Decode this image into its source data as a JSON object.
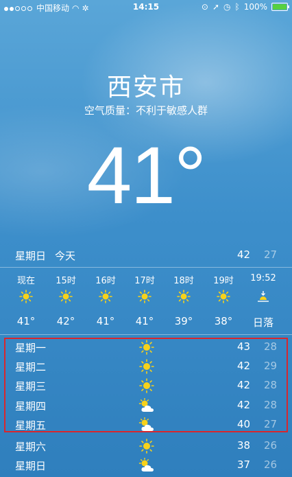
{
  "status_bar": {
    "carrier": "中国移动",
    "time": "14:15",
    "battery": "100%"
  },
  "location": {
    "city": "西安市",
    "air_quality": "空气质量：不利于敏感人群",
    "current_temp": "41°"
  },
  "today": {
    "day": "星期日",
    "label": "今天",
    "high": "42",
    "low": "27"
  },
  "hourly": [
    {
      "time": "现在",
      "icon": "sun-icon",
      "temp": "41°"
    },
    {
      "time": "15时",
      "icon": "sun-icon",
      "temp": "42°"
    },
    {
      "time": "16时",
      "icon": "sun-icon",
      "temp": "41°"
    },
    {
      "time": "17时",
      "icon": "sun-icon",
      "temp": "41°"
    },
    {
      "time": "18时",
      "icon": "sun-icon",
      "temp": "39°"
    },
    {
      "time": "19时",
      "icon": "sun-icon",
      "temp": "38°"
    },
    {
      "time": "19:52",
      "icon": "sunset-icon",
      "temp": "日落"
    }
  ],
  "daily": [
    {
      "day": "星期一",
      "icon": "sun-icon",
      "high": "43",
      "low": "28"
    },
    {
      "day": "星期二",
      "icon": "sun-icon",
      "high": "42",
      "low": "29"
    },
    {
      "day": "星期三",
      "icon": "sun-icon",
      "high": "42",
      "low": "28"
    },
    {
      "day": "星期四",
      "icon": "partly-cloudy-icon",
      "high": "42",
      "low": "28"
    },
    {
      "day": "星期五",
      "icon": "partly-cloudy-icon",
      "high": "40",
      "low": "27"
    },
    {
      "day": "星期六",
      "icon": "sun-icon",
      "high": "38",
      "low": "26"
    },
    {
      "day": "星期日",
      "icon": "partly-cloudy-icon",
      "high": "37",
      "low": "26"
    }
  ],
  "colors": {
    "sun": "#f7d21a",
    "highlight_box": "#d9262c"
  }
}
